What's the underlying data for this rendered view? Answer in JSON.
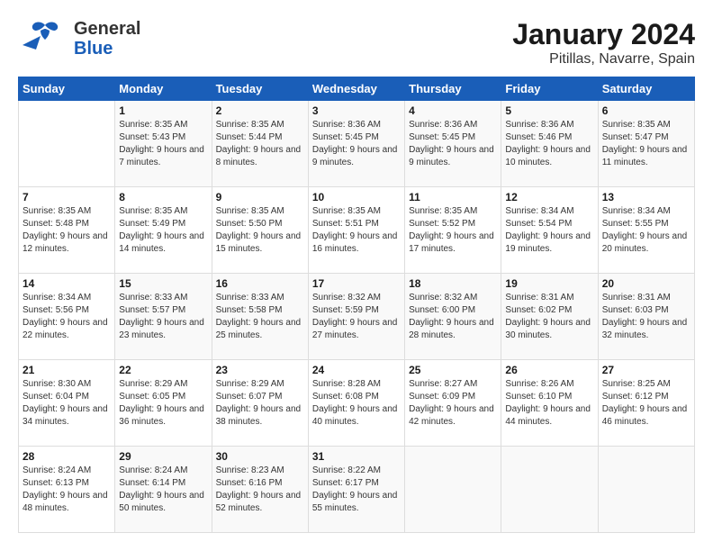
{
  "header": {
    "logo_general": "General",
    "logo_blue": "Blue",
    "title": "January 2024",
    "subtitle": "Pitillas, Navarre, Spain"
  },
  "columns": [
    "Sunday",
    "Monday",
    "Tuesday",
    "Wednesday",
    "Thursday",
    "Friday",
    "Saturday"
  ],
  "weeks": [
    [
      {
        "day": "",
        "sunrise": "",
        "sunset": "",
        "daylight": ""
      },
      {
        "day": "1",
        "sunrise": "Sunrise: 8:35 AM",
        "sunset": "Sunset: 5:43 PM",
        "daylight": "Daylight: 9 hours and 7 minutes."
      },
      {
        "day": "2",
        "sunrise": "Sunrise: 8:35 AM",
        "sunset": "Sunset: 5:44 PM",
        "daylight": "Daylight: 9 hours and 8 minutes."
      },
      {
        "day": "3",
        "sunrise": "Sunrise: 8:36 AM",
        "sunset": "Sunset: 5:45 PM",
        "daylight": "Daylight: 9 hours and 9 minutes."
      },
      {
        "day": "4",
        "sunrise": "Sunrise: 8:36 AM",
        "sunset": "Sunset: 5:45 PM",
        "daylight": "Daylight: 9 hours and 9 minutes."
      },
      {
        "day": "5",
        "sunrise": "Sunrise: 8:36 AM",
        "sunset": "Sunset: 5:46 PM",
        "daylight": "Daylight: 9 hours and 10 minutes."
      },
      {
        "day": "6",
        "sunrise": "Sunrise: 8:35 AM",
        "sunset": "Sunset: 5:47 PM",
        "daylight": "Daylight: 9 hours and 11 minutes."
      }
    ],
    [
      {
        "day": "7",
        "sunrise": "Sunrise: 8:35 AM",
        "sunset": "Sunset: 5:48 PM",
        "daylight": "Daylight: 9 hours and 12 minutes."
      },
      {
        "day": "8",
        "sunrise": "Sunrise: 8:35 AM",
        "sunset": "Sunset: 5:49 PM",
        "daylight": "Daylight: 9 hours and 14 minutes."
      },
      {
        "day": "9",
        "sunrise": "Sunrise: 8:35 AM",
        "sunset": "Sunset: 5:50 PM",
        "daylight": "Daylight: 9 hours and 15 minutes."
      },
      {
        "day": "10",
        "sunrise": "Sunrise: 8:35 AM",
        "sunset": "Sunset: 5:51 PM",
        "daylight": "Daylight: 9 hours and 16 minutes."
      },
      {
        "day": "11",
        "sunrise": "Sunrise: 8:35 AM",
        "sunset": "Sunset: 5:52 PM",
        "daylight": "Daylight: 9 hours and 17 minutes."
      },
      {
        "day": "12",
        "sunrise": "Sunrise: 8:34 AM",
        "sunset": "Sunset: 5:54 PM",
        "daylight": "Daylight: 9 hours and 19 minutes."
      },
      {
        "day": "13",
        "sunrise": "Sunrise: 8:34 AM",
        "sunset": "Sunset: 5:55 PM",
        "daylight": "Daylight: 9 hours and 20 minutes."
      }
    ],
    [
      {
        "day": "14",
        "sunrise": "Sunrise: 8:34 AM",
        "sunset": "Sunset: 5:56 PM",
        "daylight": "Daylight: 9 hours and 22 minutes."
      },
      {
        "day": "15",
        "sunrise": "Sunrise: 8:33 AM",
        "sunset": "Sunset: 5:57 PM",
        "daylight": "Daylight: 9 hours and 23 minutes."
      },
      {
        "day": "16",
        "sunrise": "Sunrise: 8:33 AM",
        "sunset": "Sunset: 5:58 PM",
        "daylight": "Daylight: 9 hours and 25 minutes."
      },
      {
        "day": "17",
        "sunrise": "Sunrise: 8:32 AM",
        "sunset": "Sunset: 5:59 PM",
        "daylight": "Daylight: 9 hours and 27 minutes."
      },
      {
        "day": "18",
        "sunrise": "Sunrise: 8:32 AM",
        "sunset": "Sunset: 6:00 PM",
        "daylight": "Daylight: 9 hours and 28 minutes."
      },
      {
        "day": "19",
        "sunrise": "Sunrise: 8:31 AM",
        "sunset": "Sunset: 6:02 PM",
        "daylight": "Daylight: 9 hours and 30 minutes."
      },
      {
        "day": "20",
        "sunrise": "Sunrise: 8:31 AM",
        "sunset": "Sunset: 6:03 PM",
        "daylight": "Daylight: 9 hours and 32 minutes."
      }
    ],
    [
      {
        "day": "21",
        "sunrise": "Sunrise: 8:30 AM",
        "sunset": "Sunset: 6:04 PM",
        "daylight": "Daylight: 9 hours and 34 minutes."
      },
      {
        "day": "22",
        "sunrise": "Sunrise: 8:29 AM",
        "sunset": "Sunset: 6:05 PM",
        "daylight": "Daylight: 9 hours and 36 minutes."
      },
      {
        "day": "23",
        "sunrise": "Sunrise: 8:29 AM",
        "sunset": "Sunset: 6:07 PM",
        "daylight": "Daylight: 9 hours and 38 minutes."
      },
      {
        "day": "24",
        "sunrise": "Sunrise: 8:28 AM",
        "sunset": "Sunset: 6:08 PM",
        "daylight": "Daylight: 9 hours and 40 minutes."
      },
      {
        "day": "25",
        "sunrise": "Sunrise: 8:27 AM",
        "sunset": "Sunset: 6:09 PM",
        "daylight": "Daylight: 9 hours and 42 minutes."
      },
      {
        "day": "26",
        "sunrise": "Sunrise: 8:26 AM",
        "sunset": "Sunset: 6:10 PM",
        "daylight": "Daylight: 9 hours and 44 minutes."
      },
      {
        "day": "27",
        "sunrise": "Sunrise: 8:25 AM",
        "sunset": "Sunset: 6:12 PM",
        "daylight": "Daylight: 9 hours and 46 minutes."
      }
    ],
    [
      {
        "day": "28",
        "sunrise": "Sunrise: 8:24 AM",
        "sunset": "Sunset: 6:13 PM",
        "daylight": "Daylight: 9 hours and 48 minutes."
      },
      {
        "day": "29",
        "sunrise": "Sunrise: 8:24 AM",
        "sunset": "Sunset: 6:14 PM",
        "daylight": "Daylight: 9 hours and 50 minutes."
      },
      {
        "day": "30",
        "sunrise": "Sunrise: 8:23 AM",
        "sunset": "Sunset: 6:16 PM",
        "daylight": "Daylight: 9 hours and 52 minutes."
      },
      {
        "day": "31",
        "sunrise": "Sunrise: 8:22 AM",
        "sunset": "Sunset: 6:17 PM",
        "daylight": "Daylight: 9 hours and 55 minutes."
      },
      {
        "day": "",
        "sunrise": "",
        "sunset": "",
        "daylight": ""
      },
      {
        "day": "",
        "sunrise": "",
        "sunset": "",
        "daylight": ""
      },
      {
        "day": "",
        "sunrise": "",
        "sunset": "",
        "daylight": ""
      }
    ]
  ]
}
